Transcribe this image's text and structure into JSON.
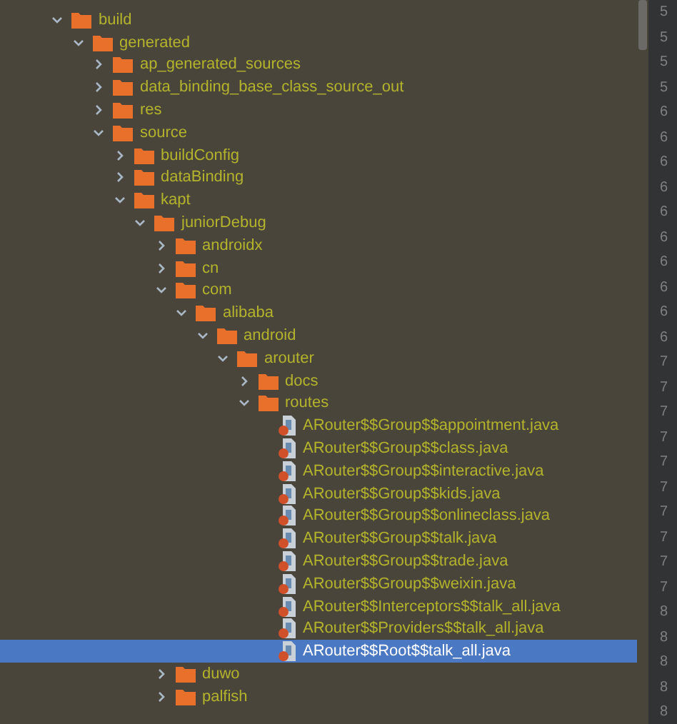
{
  "tree": [
    {
      "name": "build",
      "kind": "folder",
      "expanded": true,
      "selected": false,
      "children": [
        {
          "name": "generated",
          "kind": "folder",
          "expanded": true,
          "selected": false,
          "children": [
            {
              "name": "ap_generated_sources",
              "kind": "folder",
              "expanded": false,
              "selected": false
            },
            {
              "name": "data_binding_base_class_source_out",
              "kind": "folder",
              "expanded": false,
              "selected": false
            },
            {
              "name": "res",
              "kind": "folder",
              "expanded": false,
              "selected": false
            },
            {
              "name": "source",
              "kind": "folder",
              "expanded": true,
              "selected": false,
              "children": [
                {
                  "name": "buildConfig",
                  "kind": "folder",
                  "expanded": false,
                  "selected": false
                },
                {
                  "name": "dataBinding",
                  "kind": "folder",
                  "expanded": false,
                  "selected": false
                },
                {
                  "name": "kapt",
                  "kind": "folder",
                  "expanded": true,
                  "selected": false,
                  "children": [
                    {
                      "name": "juniorDebug",
                      "kind": "folder",
                      "expanded": true,
                      "selected": false,
                      "children": [
                        {
                          "name": "androidx",
                          "kind": "folder",
                          "expanded": false,
                          "selected": false
                        },
                        {
                          "name": "cn",
                          "kind": "folder",
                          "expanded": false,
                          "selected": false
                        },
                        {
                          "name": "com",
                          "kind": "folder",
                          "expanded": true,
                          "selected": false,
                          "children": [
                            {
                              "name": "alibaba",
                              "kind": "folder",
                              "expanded": true,
                              "selected": false,
                              "children": [
                                {
                                  "name": "android",
                                  "kind": "folder",
                                  "expanded": true,
                                  "selected": false,
                                  "children": [
                                    {
                                      "name": "arouter",
                                      "kind": "folder",
                                      "expanded": true,
                                      "selected": false,
                                      "children": [
                                        {
                                          "name": "docs",
                                          "kind": "folder",
                                          "expanded": false,
                                          "selected": false
                                        },
                                        {
                                          "name": "routes",
                                          "kind": "folder",
                                          "expanded": true,
                                          "selected": false,
                                          "children": [
                                            {
                                              "name": "ARouter$$Group$$appointment.java",
                                              "kind": "file",
                                              "selected": false
                                            },
                                            {
                                              "name": "ARouter$$Group$$class.java",
                                              "kind": "file",
                                              "selected": false
                                            },
                                            {
                                              "name": "ARouter$$Group$$interactive.java",
                                              "kind": "file",
                                              "selected": false
                                            },
                                            {
                                              "name": "ARouter$$Group$$kids.java",
                                              "kind": "file",
                                              "selected": false
                                            },
                                            {
                                              "name": "ARouter$$Group$$onlineclass.java",
                                              "kind": "file",
                                              "selected": false
                                            },
                                            {
                                              "name": "ARouter$$Group$$talk.java",
                                              "kind": "file",
                                              "selected": false
                                            },
                                            {
                                              "name": "ARouter$$Group$$trade.java",
                                              "kind": "file",
                                              "selected": false
                                            },
                                            {
                                              "name": "ARouter$$Group$$weixin.java",
                                              "kind": "file",
                                              "selected": false
                                            },
                                            {
                                              "name": "ARouter$$Interceptors$$talk_all.java",
                                              "kind": "file",
                                              "selected": false
                                            },
                                            {
                                              "name": "ARouter$$Providers$$talk_all.java",
                                              "kind": "file",
                                              "selected": false
                                            },
                                            {
                                              "name": "ARouter$$Root$$talk_all.java",
                                              "kind": "file",
                                              "selected": true
                                            }
                                          ]
                                        }
                                      ]
                                    }
                                  ]
                                }
                              ]
                            }
                          ]
                        },
                        {
                          "name": "duwo",
                          "kind": "folder",
                          "expanded": false,
                          "selected": false
                        },
                        {
                          "name": "palfish",
                          "kind": "folder",
                          "expanded": false,
                          "selected": false
                        }
                      ]
                    }
                  ]
                }
              ]
            }
          ]
        }
      ]
    }
  ],
  "line_numbers": [
    "5",
    "5",
    "5",
    "5",
    "6",
    "6",
    "6",
    "6",
    "6",
    "6",
    "6",
    "6",
    "6",
    "6",
    "7",
    "7",
    "7",
    "7",
    "7",
    "7",
    "7",
    "7",
    "7",
    "7",
    "8",
    "8",
    "8",
    "8",
    "8"
  ]
}
